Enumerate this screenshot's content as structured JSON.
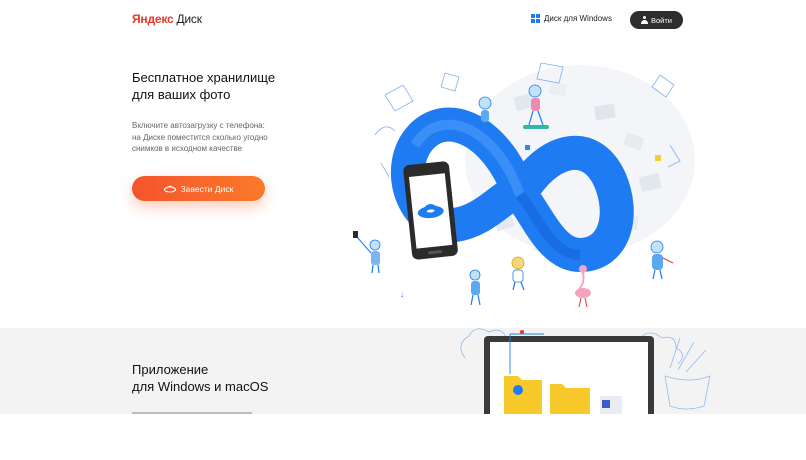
{
  "header": {
    "logo_brand": "Яндекс",
    "logo_product": "Диск",
    "windows_link": "Диск для Windows",
    "login_label": "Войти"
  },
  "hero": {
    "title_line1": "Бесплатное хранилище",
    "title_line2": "для ваших фото",
    "subtitle_line1": "Включите автозагрузку с телефона:",
    "subtitle_line2": "на Диске поместится сколько угодно",
    "subtitle_line3": "снимков в исходном качестве",
    "cta_label": "Завести Диск",
    "scroll_arrow": "↓"
  },
  "section2": {
    "title_line1": "Приложение",
    "title_line2": "для Windows и macOS"
  },
  "colors": {
    "brand_red": "#e8372b",
    "accent_blue": "#1e7bf2",
    "cta_start": "#f4542d",
    "cta_end": "#fb7a2a",
    "dark_button": "#2e2e2e",
    "section_bg": "#f3f3f3"
  },
  "icons": {
    "windows": "windows-logo-icon",
    "user": "user-icon",
    "cta": "yandex-disk-saucer-icon",
    "scroll": "arrow-down-icon"
  }
}
